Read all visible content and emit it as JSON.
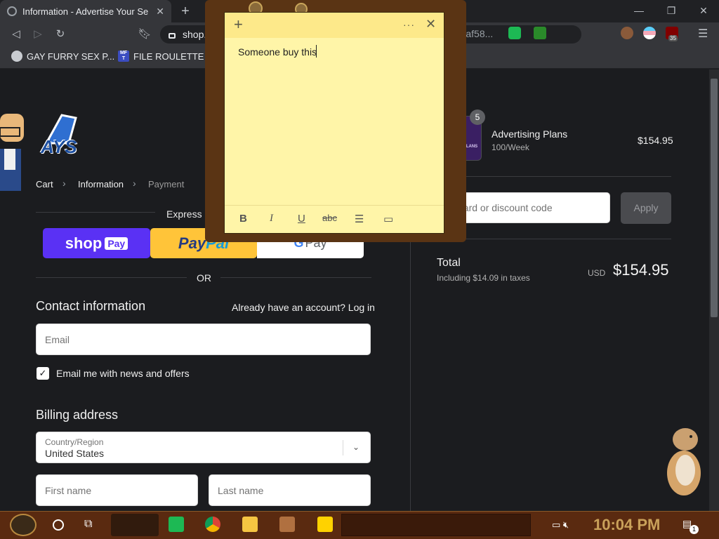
{
  "browser": {
    "tab_title": "Information - Advertise Your Se",
    "url": "shop.ays.",
    "url_tail": "527af58...",
    "ext_badge": "35",
    "bookmarks": [
      "GAY FURRY SEX P...",
      "FILE ROULETTE"
    ],
    "bookmark_icon_text": "MF T"
  },
  "sticky": {
    "text": "Someone buy this"
  },
  "store": {
    "logo": "AYS",
    "breadcrumb": [
      "Cart",
      "Information",
      "Payment"
    ],
    "express_title": "Express check",
    "shoppay": "shop",
    "shoppay_pay": "Pay",
    "paypal_1": "Pay",
    "paypal_2": "Pal",
    "gpay_g": "G",
    "gpay": "Pay",
    "or": "OR",
    "contact_title": "Contact information",
    "have_account": "Already have an account? Log in",
    "email_placeholder": "Email",
    "news_label": "Email me with news and offers",
    "billing_title": "Billing address",
    "country_label": "Country/Region",
    "country_value": "United States",
    "first_name": "First name",
    "last_name": "Last name"
  },
  "summary": {
    "qty": "5",
    "product_name": "Advertising Plans",
    "product_variant": "100/Week",
    "product_price": "$154.95",
    "thumb_text": "RTISING LANS",
    "discount_placeholder": "t card or discount code",
    "apply": "Apply",
    "total_label": "Total",
    "tax_label": "Including $14.09 in taxes",
    "currency": "USD",
    "total_value": "$154.95"
  },
  "taskbar": {
    "clock": "10:04 PM",
    "notif_count": "1"
  }
}
